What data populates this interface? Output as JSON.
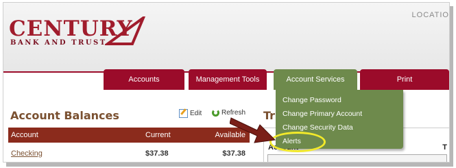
{
  "header": {
    "logo_main": "CENTURY",
    "logo_sub": "BANK AND TRUST",
    "location_label": "LOCATIO"
  },
  "tabs": [
    {
      "label": "Accounts"
    },
    {
      "label": "Management Tools"
    },
    {
      "label": "Account Services"
    },
    {
      "label": "Print"
    }
  ],
  "account_services_menu": [
    {
      "label": "Change Password"
    },
    {
      "label": "Change Primary Account"
    },
    {
      "label": "Change Security Data"
    },
    {
      "label": "Alerts"
    }
  ],
  "balances": {
    "title": "Account Balances",
    "edit_label": "Edit",
    "refresh_label": "Refresh",
    "columns": [
      "Account",
      "Current",
      "Available"
    ],
    "rows": [
      {
        "account": "Checking",
        "current": "$37.38",
        "available": "$37.38"
      }
    ]
  },
  "right_panel": {
    "title": "Tr",
    "column_account": "Account",
    "column_t": "T"
  },
  "colors": {
    "brand_red": "#9b0b2a",
    "services_green": "#6e8a4c",
    "highlight_yellow": "#f2e92a"
  }
}
